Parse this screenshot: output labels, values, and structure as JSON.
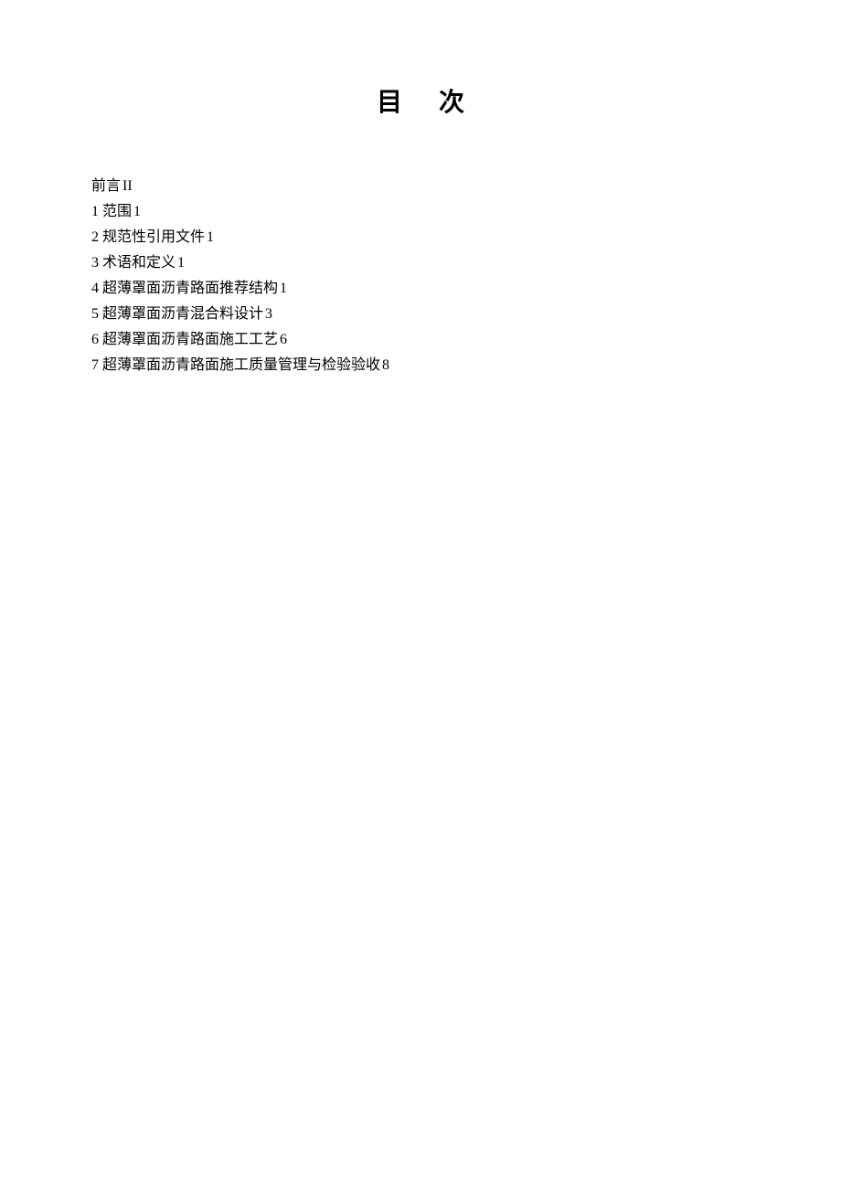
{
  "title": "目次",
  "toc": [
    {
      "label": "前言",
      "page": "II"
    },
    {
      "label": "1 范围",
      "page": "1"
    },
    {
      "label": "2 规范性引用文件",
      "page": "1"
    },
    {
      "label": "3 术语和定义",
      "page": "1"
    },
    {
      "label": "4 超薄罩面沥青路面推荐结构",
      "page": "1"
    },
    {
      "label": "5 超薄罩面沥青混合料设计",
      "page": "3"
    },
    {
      "label": "6 超薄罩面沥青路面施工工艺",
      "page": "6"
    },
    {
      "label": "7 超薄罩面沥青路面施工质量管理与检验验收",
      "page": "8"
    }
  ]
}
